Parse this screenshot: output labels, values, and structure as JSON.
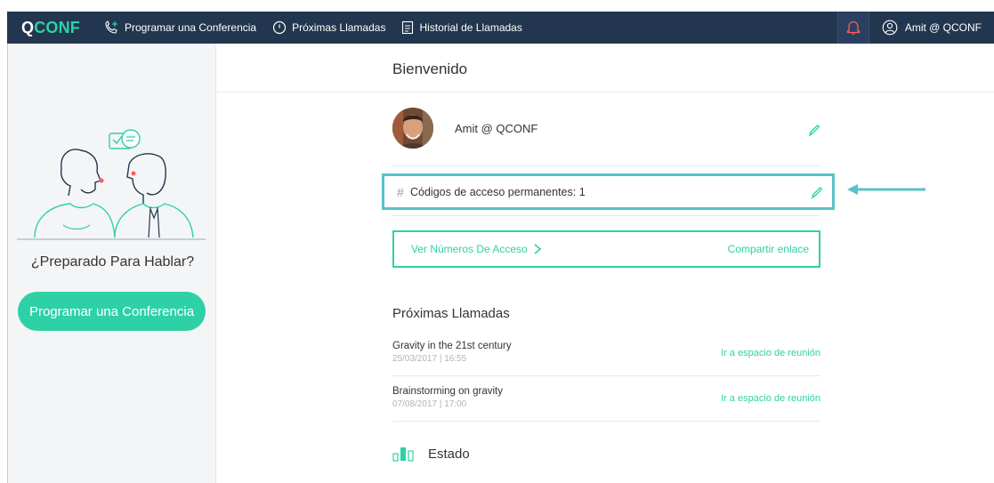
{
  "brand": {
    "logo": "QCONF",
    "logo_q": "Q",
    "logo_conf": "CONF"
  },
  "nav": {
    "schedule": "Programar una Conferencia",
    "upcoming": "Próximas Llamadas",
    "history": "Historial de Llamadas",
    "user": "Amit @ QCONF"
  },
  "sidebar": {
    "ready": "¿Preparado Para Hablar?",
    "cta": "Programar una Conferencia"
  },
  "main": {
    "welcome": "Bienvenido",
    "profile_name": "Amit @ QCONF",
    "codes_hash": "#",
    "codes_label": "Códigos de acceso permanentes: 1",
    "access_numbers": "Ver Números De Acceso",
    "share_link": "Compartir enlace",
    "upcoming_title": "Próximas Llamadas",
    "calls": [
      {
        "name": "Gravity in the 21st century",
        "datetime": "25/03/2017 | 16:55",
        "action": "Ir a espacio de reunión"
      },
      {
        "name": "Brainstorming on gravity",
        "datetime": "07/08/2017 | 17:00",
        "action": "Ir a espacio de reunión"
      }
    ],
    "status_title": "Estado"
  },
  "colors": {
    "accent": "#2ed1a6",
    "navbar": "#22364f",
    "highlight": "#5bc0c9",
    "bell": "#ff5b5b"
  }
}
